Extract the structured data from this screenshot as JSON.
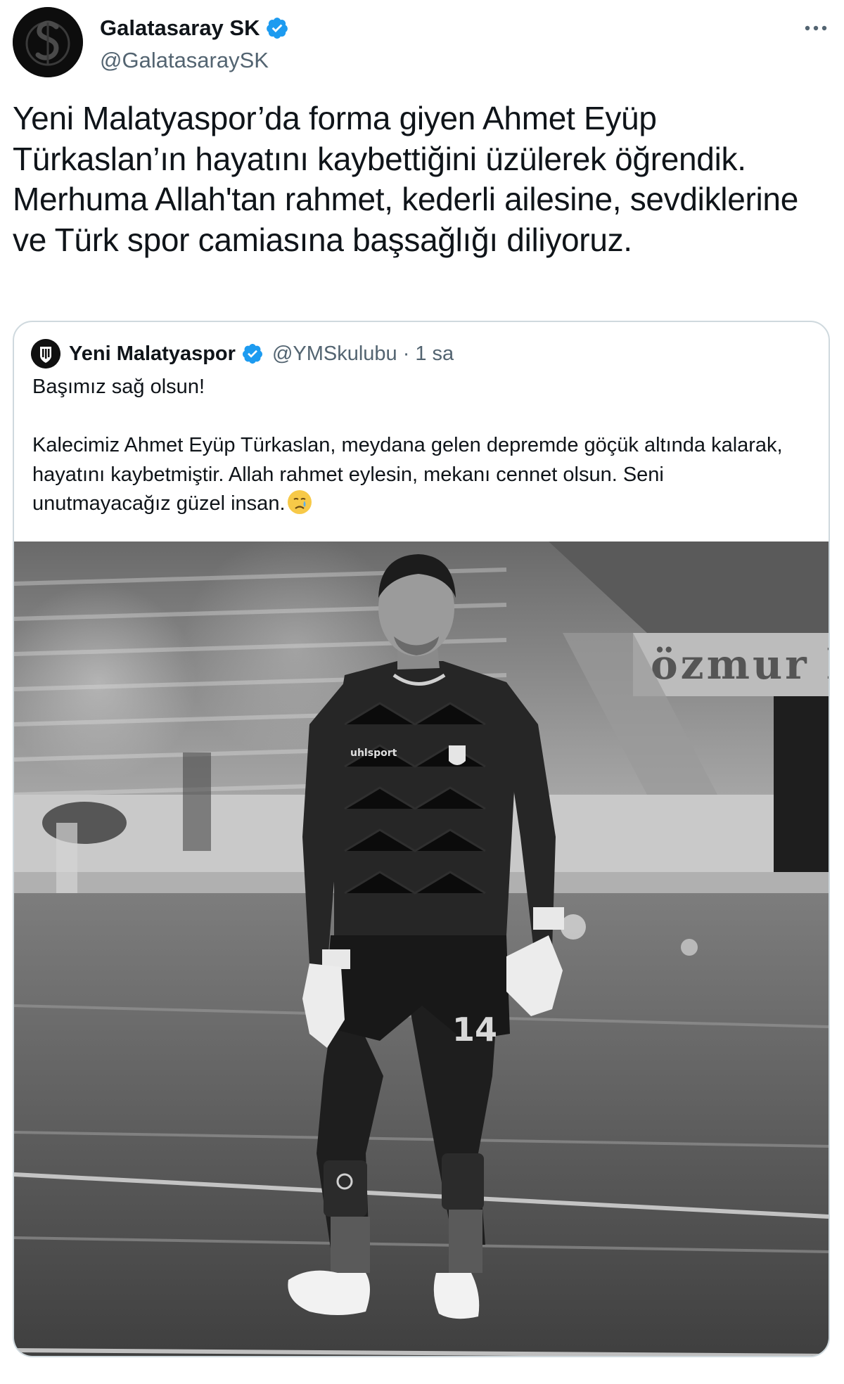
{
  "tweet": {
    "author": {
      "display_name": "Galatasaray SK",
      "handle": "@GalatasaraySK",
      "verified": true,
      "avatar_icon": "galatasaray-crest-icon"
    },
    "text": "Yeni Malatyaspor’da forma giyen Ahmet Eyüp Türkaslan’ın hayatını kaybettiğini üzülerek öğrendik. Merhuma Allah'tan rahmet, kederli ailesine, sevdiklerine ve Türk spor camiasına başsağlığı diliyoruz.",
    "more_icon": "more-options-icon"
  },
  "quoted_tweet": {
    "author": {
      "display_name": "Yeni Malatyaspor",
      "handle": "@YMSkulubu",
      "verified": true,
      "avatar_icon": "yeni-malatyaspor-crest-icon"
    },
    "separator": "·",
    "time": "1 sa",
    "paragraph_1": "Başımız sağ olsun!",
    "paragraph_2": "Kalecimiz Ahmet Eyüp Türkaslan, meydana gelen depremde göçük altında kalarak, hayatını kaybetmiştir. Allah rahmet eylesin, mekanı cennet olsun. Seni unutmayacağız güzel insan.",
    "emoji": "crying-face-emoji",
    "image": {
      "description_icon": "goalkeeper-photo",
      "kit_brand": "uhlsport",
      "shirt_number": "14",
      "banner_text": "özmur k"
    }
  },
  "colors": {
    "text_primary": "#0f1419",
    "text_secondary": "#536471",
    "verified_blue": "#1d9bf0",
    "border": "#cfd9de"
  }
}
